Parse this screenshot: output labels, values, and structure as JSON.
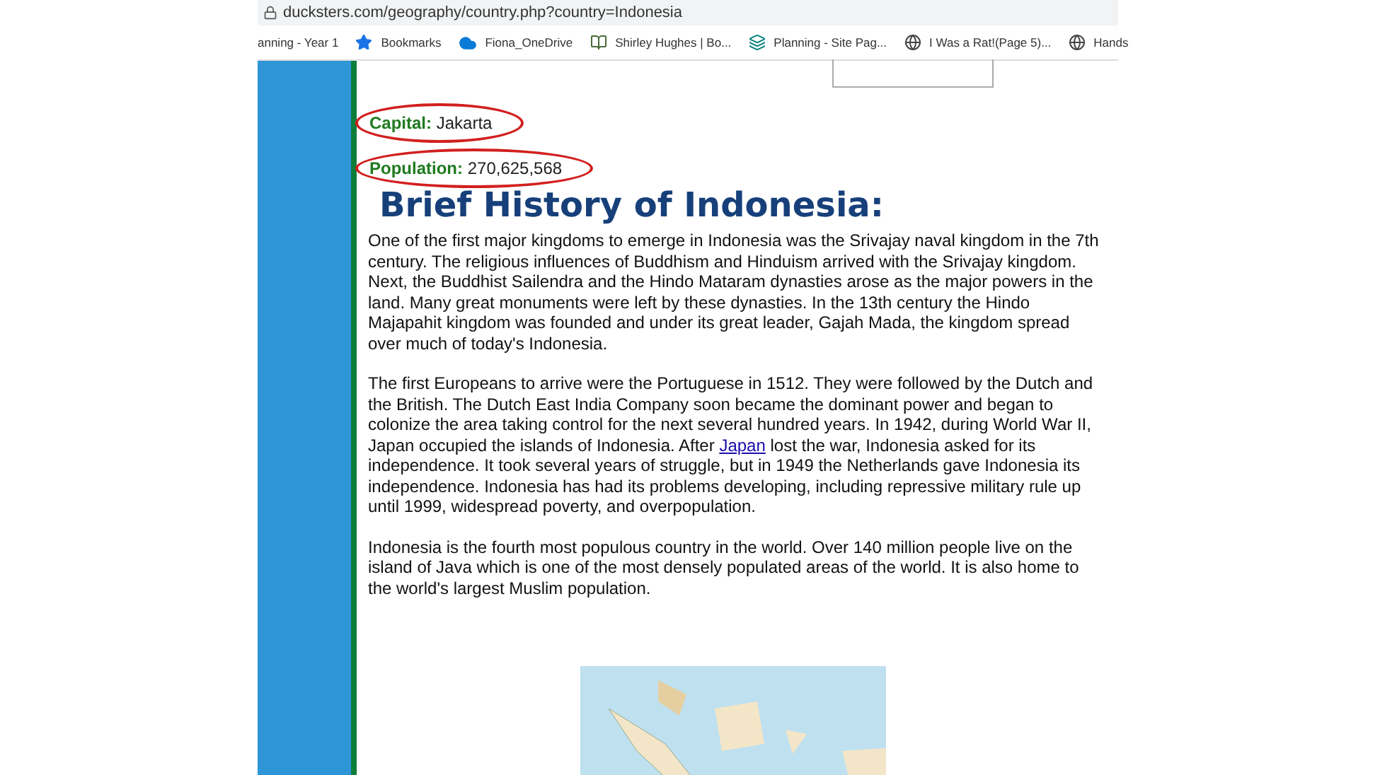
{
  "address_bar": {
    "url": "ducksters.com/geography/country.php?country=Indonesia"
  },
  "bookmarks": [
    {
      "label": "anning - Year 1",
      "kind": "none"
    },
    {
      "label": "Bookmarks",
      "kind": "star"
    },
    {
      "label": "Fiona_OneDrive",
      "kind": "cloud"
    },
    {
      "label": "Shirley Hughes | Bo...",
      "kind": "book"
    },
    {
      "label": "Planning - Site Pag...",
      "kind": "site"
    },
    {
      "label": "I Was a Rat!(Page 5)...",
      "kind": "globe"
    },
    {
      "label": "Hands",
      "kind": "globe"
    }
  ],
  "facts": [
    {
      "label": "Capital:",
      "value": "Jakarta",
      "circled": true
    },
    {
      "label": "Population:",
      "value": "270,625,568",
      "circled": true
    }
  ],
  "heading": "Brief History of Indonesia:",
  "paragraphs": [
    {
      "before": "One of the first major kingdoms to emerge in Indonesia was the Srivajay naval kingdom in the 7th century. The religious influences of Buddhism and Hinduism arrived with the Srivajay kingdom. Next, the Buddhist Sailendra and the Hindo Mataram dynasties arose as the major powers in the land. Many great monuments were left by these dynasties. In the 13th century the Hindo Majapahit kingdom was founded and under its great leader, Gajah Mada, the kingdom spread over much of today's Indonesia."
    },
    {
      "before": "The first Europeans to arrive were the Portuguese in 1512. They were followed by the Dutch and the British. The Dutch East India Company soon became the dominant power and began to colonize the area taking control for the next several hundred years. In 1942, during World War II, Japan occupied the islands of Indonesia. After",
      "link": "Japan",
      "after": "lost the war, Indonesia asked for its independence. It took several years of struggle, but in 1949 the Netherlands gave Indonesia its independence. Indonesia has had its problems developing, including repressive military rule up until 1999, widespread poverty, and overpopulation."
    },
    {
      "before": "Indonesia is the fourth most populous country in the world. Over 140 million people live on the island of Java which is one of the most densely populated areas of the world. It is also home to the world's largest Muslim population."
    }
  ]
}
